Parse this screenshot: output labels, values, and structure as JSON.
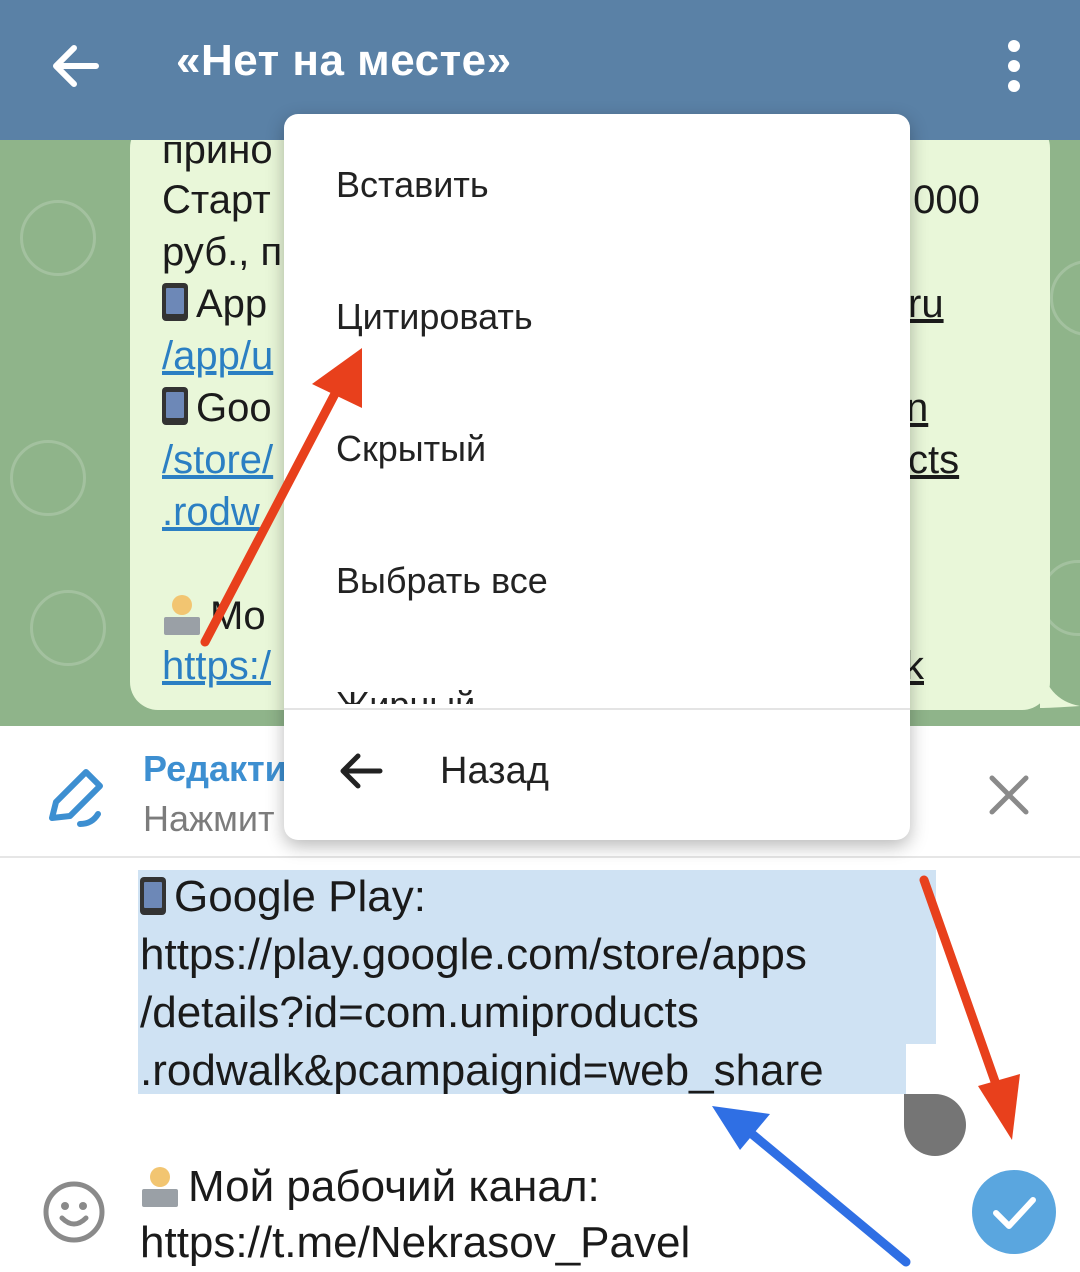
{
  "header": {
    "title": "«Нет на месте»",
    "background": "#5a81a6"
  },
  "message": {
    "lines_left": [
      "прино",
      "Старт",
      "руб., п",
      "App",
      "/app/u",
      "Goo",
      "/store/",
      ".rodw",
      "",
      "Mo",
      "https:/"
    ],
    "lines_right": [
      ".000",
      "ru",
      "n",
      "cts",
      "k"
    ]
  },
  "context_menu": {
    "items": [
      "Вставить",
      "Цитировать",
      "Скрытый",
      "Выбрать все"
    ],
    "partial_item": "Жирный",
    "back_label": "Назад"
  },
  "edit_panel": {
    "title": "Редакти",
    "subtitle": "Нажмит",
    "accent": "#3d8fd1"
  },
  "input": {
    "lines": [
      "Google Play:",
      "https://play.google.com/store/apps",
      "/details?id=com.umiproducts",
      ".rodwalk&pcampaignid=web_share",
      "",
      "Мой рабочий канал:",
      "https://t.me/Nekrasov_Pavel"
    ],
    "selection_color": "#cfe2f3"
  },
  "annotations": {
    "red_arrow_color": "#e8401c",
    "blue_arrow_color": "#2f6fe4"
  }
}
